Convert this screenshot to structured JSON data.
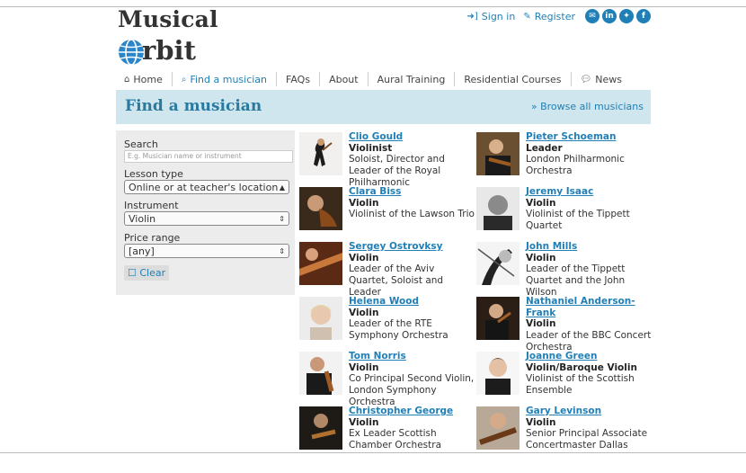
{
  "logo": {
    "line1": "Musical",
    "line2": "rbit"
  },
  "toplinks": {
    "signin": "Sign in",
    "register": "Register"
  },
  "social": [
    "email-icon",
    "linkedin-icon",
    "twitter-icon",
    "facebook-icon"
  ],
  "nav": [
    {
      "icon": "home-icon",
      "label": "Home"
    },
    {
      "icon": "search-icon",
      "label": "Find a musician"
    },
    {
      "icon": "",
      "label": "FAQs"
    },
    {
      "icon": "",
      "label": "About"
    },
    {
      "icon": "",
      "label": "Aural Training"
    },
    {
      "icon": "",
      "label": "Residential Courses"
    },
    {
      "icon": "comments-icon",
      "label": "News"
    }
  ],
  "header": {
    "title": "Find a musician",
    "browse": "» Browse all musicians"
  },
  "filters": {
    "search_label": "Search",
    "search_placeholder": "E.g. Musician name or instrument",
    "lesson_label": "Lesson type",
    "lesson_value": "Online or at teacher's location",
    "instrument_label": "Instrument",
    "instrument_value": "Violin",
    "price_label": "Price range",
    "price_value": "[any]",
    "clear_label": "Clear"
  },
  "musicians": [
    {
      "name": "Clio Gould",
      "instrument": "Violinist",
      "desc": "Soloist, Director and Leader of the Royal Philharmonic"
    },
    {
      "name": "Pieter Schoeman",
      "instrument": "Leader",
      "desc": "London Philharmonic Orchestra"
    },
    {
      "name": "Clara Biss",
      "instrument": "Violin",
      "desc": "Violinist of the Lawson Trio"
    },
    {
      "name": "Jeremy Isaac",
      "instrument": "Violin",
      "desc": "Violinist of the Tippett Quartet"
    },
    {
      "name": "Sergey Ostrovksy",
      "instrument": "Violin",
      "desc": "Leader of the Aviv Quartet, Soloist and Leader"
    },
    {
      "name": "John Mills",
      "instrument": "Violin",
      "desc": "Leader of the Tippett Quartet and the John Wilson"
    },
    {
      "name": "Helena Wood",
      "instrument": "Violin",
      "desc": "Leader of the RTE Symphony Orchestra"
    },
    {
      "name": "Nathaniel Anderson-Frank",
      "instrument": "Violin",
      "desc": "Leader of the BBC Concert Orchestra"
    },
    {
      "name": "Tom Norris",
      "instrument": "Violin",
      "desc": "Co Principal Second Violin, London Symphony Orchestra"
    },
    {
      "name": "Joanne Green",
      "instrument": "Violin/Baroque Violin",
      "desc": "Violinist of the Scottish Ensemble"
    },
    {
      "name": "Christopher George",
      "instrument": "Violin",
      "desc": "Ex Leader Scottish Chamber Orchestra"
    },
    {
      "name": "Gary Levinson",
      "instrument": "Violin",
      "desc": "Senior Principal Associate Concertmaster Dallas"
    }
  ]
}
